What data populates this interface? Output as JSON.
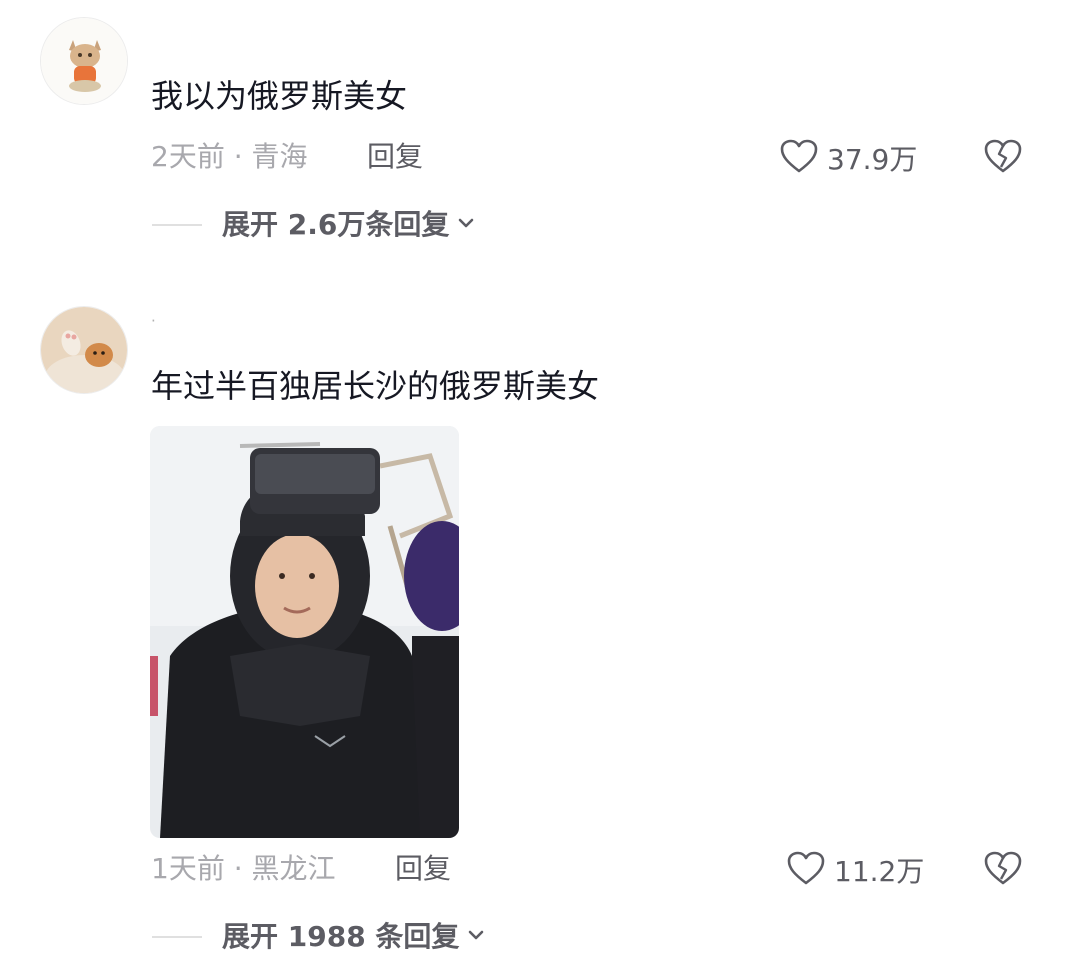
{
  "comments": [
    {
      "avatar": "cat-mascot-avatar",
      "username": "",
      "text": "我以为俄罗斯美女",
      "meta": "2天前 · 青海",
      "reply_label": "回复",
      "likes": "37.9万",
      "expand_label": "展开 2.6万条回复"
    },
    {
      "avatar": "cat-paw-avatar",
      "username": "·",
      "text": "年过半百独居长沙的俄罗斯美女",
      "image": "woman-ski-helmet-photo",
      "meta": "1天前 · 黑龙江",
      "reply_label": "回复",
      "likes": "11.2万",
      "expand_label": "展开 1988 条回复"
    }
  ],
  "icons": {
    "like": "heart-outline-icon",
    "dislike": "broken-heart-icon",
    "expand": "chevron-down-icon"
  },
  "colors": {
    "text_primary": "#161823",
    "text_secondary": "#a8a8ad",
    "text_action": "#5c5c63"
  }
}
